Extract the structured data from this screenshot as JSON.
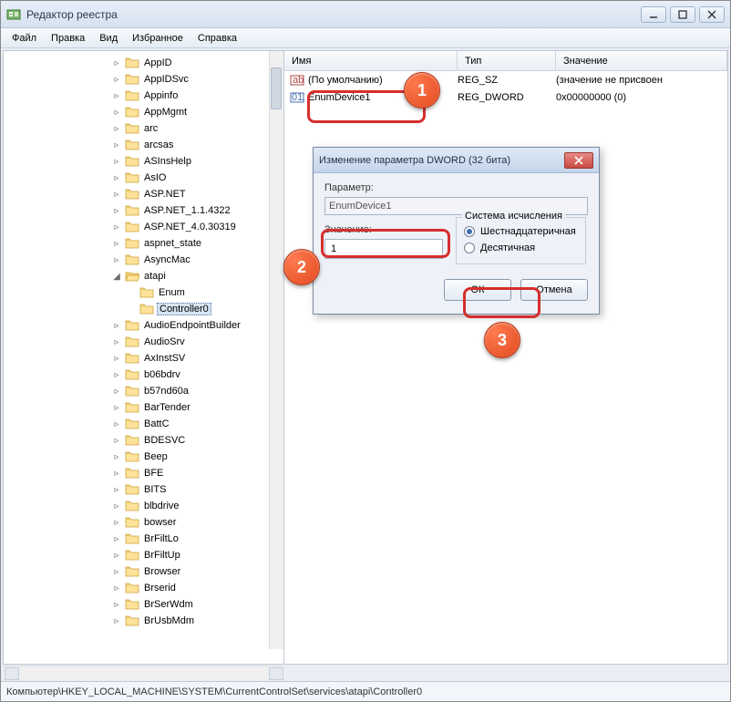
{
  "window": {
    "title": "Редактор реестра"
  },
  "menu": [
    "Файл",
    "Правка",
    "Вид",
    "Избранное",
    "Справка"
  ],
  "columns": {
    "name": "Имя",
    "type": "Тип",
    "value": "Значение"
  },
  "column_widths": {
    "name": 190,
    "type": 108,
    "value": 160
  },
  "rows": [
    {
      "name": "(По умолчанию)",
      "type": "REG_SZ",
      "value": "(значение не присвоен",
      "icon": "sz"
    },
    {
      "name": "EnumDevice1",
      "type": "REG_DWORD",
      "value": "0x00000000 (0)",
      "icon": "dword"
    }
  ],
  "tree": [
    {
      "label": "AppID",
      "d": 0,
      "tw": "▹"
    },
    {
      "label": "AppIDSvc",
      "d": 0,
      "tw": "▹"
    },
    {
      "label": "Appinfo",
      "d": 0,
      "tw": "▹"
    },
    {
      "label": "AppMgmt",
      "d": 0,
      "tw": "▹"
    },
    {
      "label": "arc",
      "d": 0,
      "tw": "▹"
    },
    {
      "label": "arcsas",
      "d": 0,
      "tw": "▹"
    },
    {
      "label": "ASInsHelp",
      "d": 0,
      "tw": "▹"
    },
    {
      "label": "AsIO",
      "d": 0,
      "tw": "▹"
    },
    {
      "label": "ASP.NET",
      "d": 0,
      "tw": "▹"
    },
    {
      "label": "ASP.NET_1.1.4322",
      "d": 0,
      "tw": "▹"
    },
    {
      "label": "ASP.NET_4.0.30319",
      "d": 0,
      "tw": "▹"
    },
    {
      "label": "aspnet_state",
      "d": 0,
      "tw": "▹"
    },
    {
      "label": "AsyncMac",
      "d": 0,
      "tw": "▹"
    },
    {
      "label": "atapi",
      "d": 0,
      "tw": "◢",
      "open": true
    },
    {
      "label": "Enum",
      "d": 1,
      "tw": ""
    },
    {
      "label": "Controller0",
      "d": 1,
      "tw": "",
      "sel": true
    },
    {
      "label": "AudioEndpointBuilder",
      "d": 0,
      "tw": "▹"
    },
    {
      "label": "AudioSrv",
      "d": 0,
      "tw": "▹"
    },
    {
      "label": "AxInstSV",
      "d": 0,
      "tw": "▹"
    },
    {
      "label": "b06bdrv",
      "d": 0,
      "tw": "▹"
    },
    {
      "label": "b57nd60a",
      "d": 0,
      "tw": "▹"
    },
    {
      "label": "BarTender",
      "d": 0,
      "tw": "▹"
    },
    {
      "label": "BattC",
      "d": 0,
      "tw": "▹"
    },
    {
      "label": "BDESVC",
      "d": 0,
      "tw": "▹"
    },
    {
      "label": "Beep",
      "d": 0,
      "tw": "▹"
    },
    {
      "label": "BFE",
      "d": 0,
      "tw": "▹"
    },
    {
      "label": "BITS",
      "d": 0,
      "tw": "▹"
    },
    {
      "label": "blbdrive",
      "d": 0,
      "tw": "▹"
    },
    {
      "label": "bowser",
      "d": 0,
      "tw": "▹"
    },
    {
      "label": "BrFiltLo",
      "d": 0,
      "tw": "▹"
    },
    {
      "label": "BrFiltUp",
      "d": 0,
      "tw": "▹"
    },
    {
      "label": "Browser",
      "d": 0,
      "tw": "▹"
    },
    {
      "label": "Brserid",
      "d": 0,
      "tw": "▹"
    },
    {
      "label": "BrSerWdm",
      "d": 0,
      "tw": "▹"
    },
    {
      "label": "BrUsbMdm",
      "d": 0,
      "tw": "▹"
    }
  ],
  "dialog": {
    "title": "Изменение параметра DWORD (32 бита)",
    "param_label": "Параметр:",
    "param_value": "EnumDevice1",
    "value_label": "Значение:",
    "value_input": "1",
    "base_label": "Система исчисления",
    "radio_hex": "Шестнадцатеричная",
    "radio_dec": "Десятичная",
    "ok": "ОК",
    "cancel": "Отмена"
  },
  "status": "Компьютер\\HKEY_LOCAL_MACHINE\\SYSTEM\\CurrentControlSet\\services\\atapi\\Controller0",
  "badges": {
    "1": "1",
    "2": "2",
    "3": "3"
  }
}
